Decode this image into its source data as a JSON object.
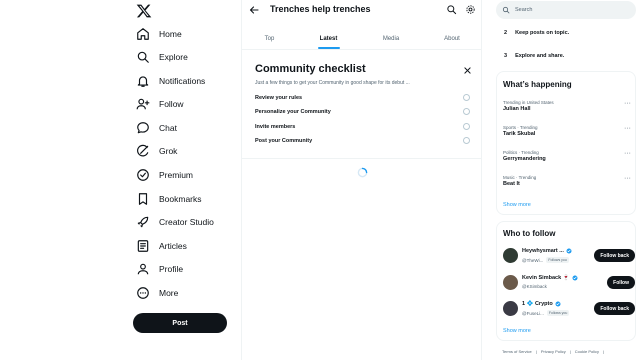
{
  "nav": {
    "items": [
      {
        "label": "Home",
        "icon": "home-icon"
      },
      {
        "label": "Explore",
        "icon": "search-icon"
      },
      {
        "label": "Notifications",
        "icon": "bell-icon"
      },
      {
        "label": "Follow",
        "icon": "person-add-icon"
      },
      {
        "label": "Chat",
        "icon": "chat-icon"
      },
      {
        "label": "Grok",
        "icon": "grok-icon"
      },
      {
        "label": "Premium",
        "icon": "premium-icon"
      },
      {
        "label": "Bookmarks",
        "icon": "bookmark-icon"
      },
      {
        "label": "Creator Studio",
        "icon": "rocket-icon"
      },
      {
        "label": "Articles",
        "icon": "article-icon"
      },
      {
        "label": "Profile",
        "icon": "profile-icon"
      },
      {
        "label": "More",
        "icon": "more-circle-icon"
      }
    ],
    "post_label": "Post"
  },
  "main": {
    "title": "Trenches help trenches",
    "tabs": [
      {
        "label": "Top"
      },
      {
        "label": "Latest"
      },
      {
        "label": "Media"
      },
      {
        "label": "About"
      }
    ],
    "active_tab": "Latest",
    "checklist": {
      "title": "Community checklist",
      "subtitle": "Just a few things to get your Community in good shape for its debut ...",
      "items": [
        {
          "label": "Review your rules"
        },
        {
          "label": "Personalize your Community"
        },
        {
          "label": "Invite members"
        },
        {
          "label": "Post your Community"
        }
      ]
    }
  },
  "right": {
    "search": {
      "placeholder": "Search"
    },
    "rules": [
      {
        "num": "2",
        "text": "Keep posts on topic."
      },
      {
        "num": "3",
        "text": "Explore and share."
      }
    ],
    "happening": {
      "title": "What’s happening",
      "trends": [
        {
          "context": "Trending in United States",
          "name": "Julian Hall"
        },
        {
          "context": "Sports · Trending",
          "name": "Tarik Skubal"
        },
        {
          "context": "Politics · Trending",
          "name": "Gerrymandering"
        },
        {
          "context": "Music · Trending",
          "name": "Beat It"
        }
      ],
      "show_more": "Show more"
    },
    "who_to_follow": {
      "title": "Who to follow",
      "accounts": [
        {
          "name": "Heywhysmart ...",
          "handle": "@TheWi...",
          "follows_you": "Follows you",
          "button": "Follow back",
          "avatar_color": "#2f3b33"
        },
        {
          "name": "Kevin Simback 🍷",
          "handle": "@KSimback",
          "follows_you": "",
          "button": "Follow",
          "avatar_color": "#6b5a4a"
        },
        {
          "name": "1 💠 Crypto",
          "handle": "@FuseLi...",
          "follows_you": "Follows you",
          "button": "Follow back",
          "avatar_color": "#3a3a44"
        }
      ],
      "show_more": "Show more"
    },
    "footer": [
      "Terms of Service",
      "|",
      "Privacy Policy",
      "|",
      "Cookie Policy",
      "|"
    ]
  },
  "colors": {
    "accent": "#1d9bf0",
    "text": "#0f1419",
    "muted": "#536471",
    "border": "#eff3f4"
  }
}
